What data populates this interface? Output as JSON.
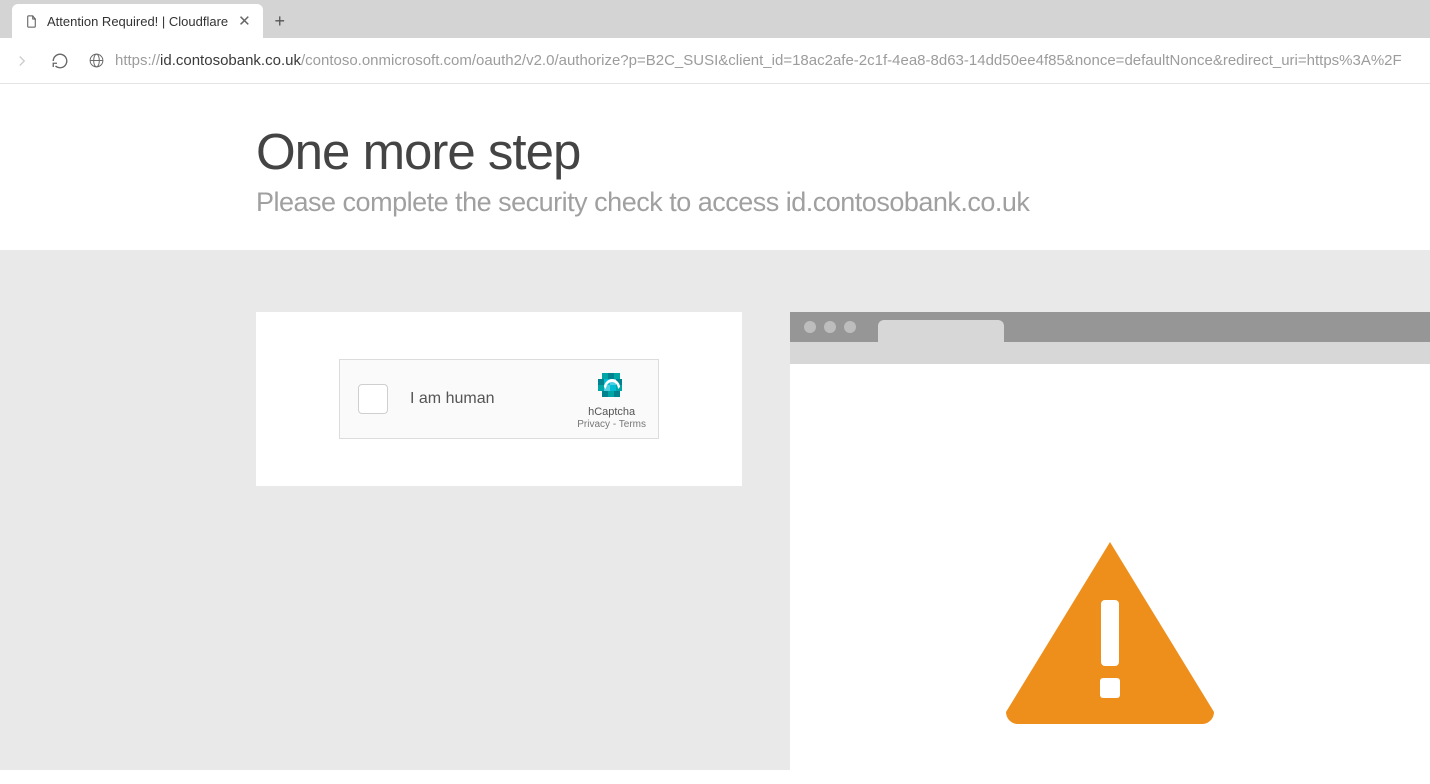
{
  "browser": {
    "tab_title": "Attention Required! | Cloudflare",
    "url_protocol": "https://",
    "url_host": "id.contosobank.co.uk",
    "url_path": "/contoso.onmicrosoft.com/oauth2/v2.0/authorize?p=B2C_SUSI&client_id=18ac2afe-2c1f-4ea8-8d63-14dd50ee4f85&nonce=defaultNonce&redirect_uri=https%3A%2F"
  },
  "page": {
    "title": "One more step",
    "subtitle": "Please complete the security check to access id.contosobank.co.uk"
  },
  "captcha": {
    "label": "I am human",
    "brand": "hCaptcha",
    "privacy": "Privacy",
    "separator": " - ",
    "terms": "Terms"
  }
}
